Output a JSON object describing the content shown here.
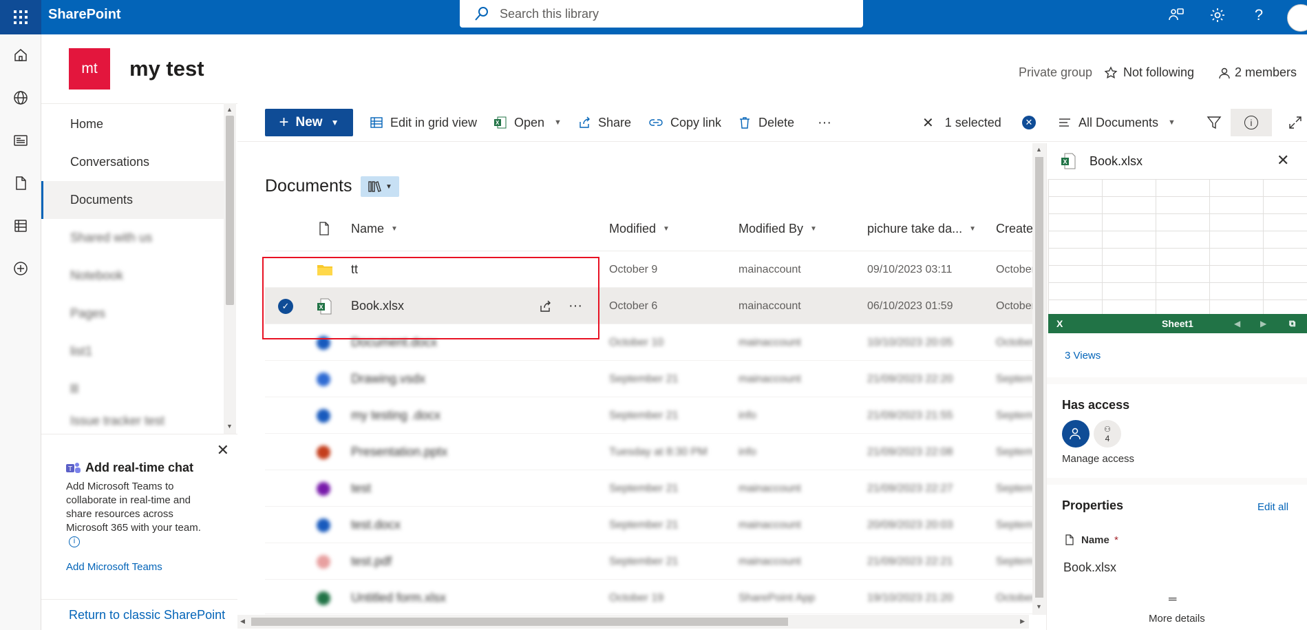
{
  "suite": {
    "brand": "SharePoint",
    "search_placeholder": "Search this library"
  },
  "site": {
    "logo_initials": "mt",
    "title": "my test",
    "privacy": "Private group",
    "follow_label": "Not following",
    "members_label": "2 members"
  },
  "leftnav": {
    "items": [
      {
        "label": "Home"
      },
      {
        "label": "Conversations"
      },
      {
        "label": "Documents"
      },
      {
        "label": "Shared with us"
      },
      {
        "label": "Notebook"
      },
      {
        "label": "Pages"
      },
      {
        "label": "list1"
      },
      {
        "label": "lll"
      },
      {
        "label": "Issue tracker test"
      }
    ]
  },
  "teams": {
    "title": "Add real-time chat",
    "body": "Add Microsoft Teams to collaborate in real-time and share resources across Microsoft 365 with your team.",
    "link": "Add Microsoft Teams"
  },
  "return_link": "Return to classic SharePoint",
  "commandbar": {
    "new": "New",
    "edit_grid": "Edit in grid view",
    "open": "Open",
    "share": "Share",
    "copy_link": "Copy link",
    "delete": "Delete",
    "more": "···",
    "selected": "1 selected",
    "view": "All Documents"
  },
  "library": {
    "title": "Documents",
    "columns": {
      "name": "Name",
      "modified": "Modified",
      "modified_by": "Modified By",
      "picture": "pichure take da...",
      "created": "Create"
    },
    "rows": [
      {
        "name": "tt",
        "modified": "October 9",
        "by": "mainaccount",
        "pic": "09/10/2023 03:11",
        "created": "October"
      },
      {
        "name": "Book.xlsx",
        "modified": "October 6",
        "by": "mainaccount",
        "pic": "06/10/2023 01:59",
        "created": "October"
      },
      {
        "name": "Document.docx",
        "modified": "October 10",
        "by": "mainaccount",
        "pic": "10/10/2023 20:05",
        "created": "October"
      },
      {
        "name": "Drawing.vsdx",
        "modified": "September 21",
        "by": "mainaccount",
        "pic": "21/09/2023 22:20",
        "created": "Septem"
      },
      {
        "name": "my testing .docx",
        "modified": "September 21",
        "by": "info",
        "pic": "21/09/2023 21:55",
        "created": "Septem"
      },
      {
        "name": "Presentation.pptx",
        "modified": "Tuesday at 8:30 PM",
        "by": "info",
        "pic": "21/09/2023 22:08",
        "created": "Septem"
      },
      {
        "name": "test",
        "modified": "September 21",
        "by": "mainaccount",
        "pic": "21/09/2023 22:27",
        "created": "Septem"
      },
      {
        "name": "test.docx",
        "modified": "September 21",
        "by": "mainaccount",
        "pic": "20/09/2023 20:03",
        "created": "Septem"
      },
      {
        "name": "test.pdf",
        "modified": "September 21",
        "by": "mainaccount",
        "pic": "21/09/2023 22:21",
        "created": "Septem"
      },
      {
        "name": "Untitled form.xlsx",
        "modified": "October 19",
        "by": "SharePoint App",
        "pic": "19/10/2023 21:20",
        "created": "October"
      }
    ]
  },
  "details": {
    "file_name": "Book.xlsx",
    "sheet_name": "Sheet1",
    "views": "3 Views",
    "has_access": "Has access",
    "access_count": "4",
    "manage_access": "Manage access",
    "properties": "Properties",
    "edit_all": "Edit all",
    "name_label": "Name",
    "required_mark": "*",
    "name_value": "Book.xlsx",
    "more_details": "More details"
  },
  "colors": {
    "suitebar": "#0364b8",
    "accent": "#0f4c96",
    "site_logo": "#e3163d",
    "excel": "#217346",
    "highlight": "#e81123"
  }
}
